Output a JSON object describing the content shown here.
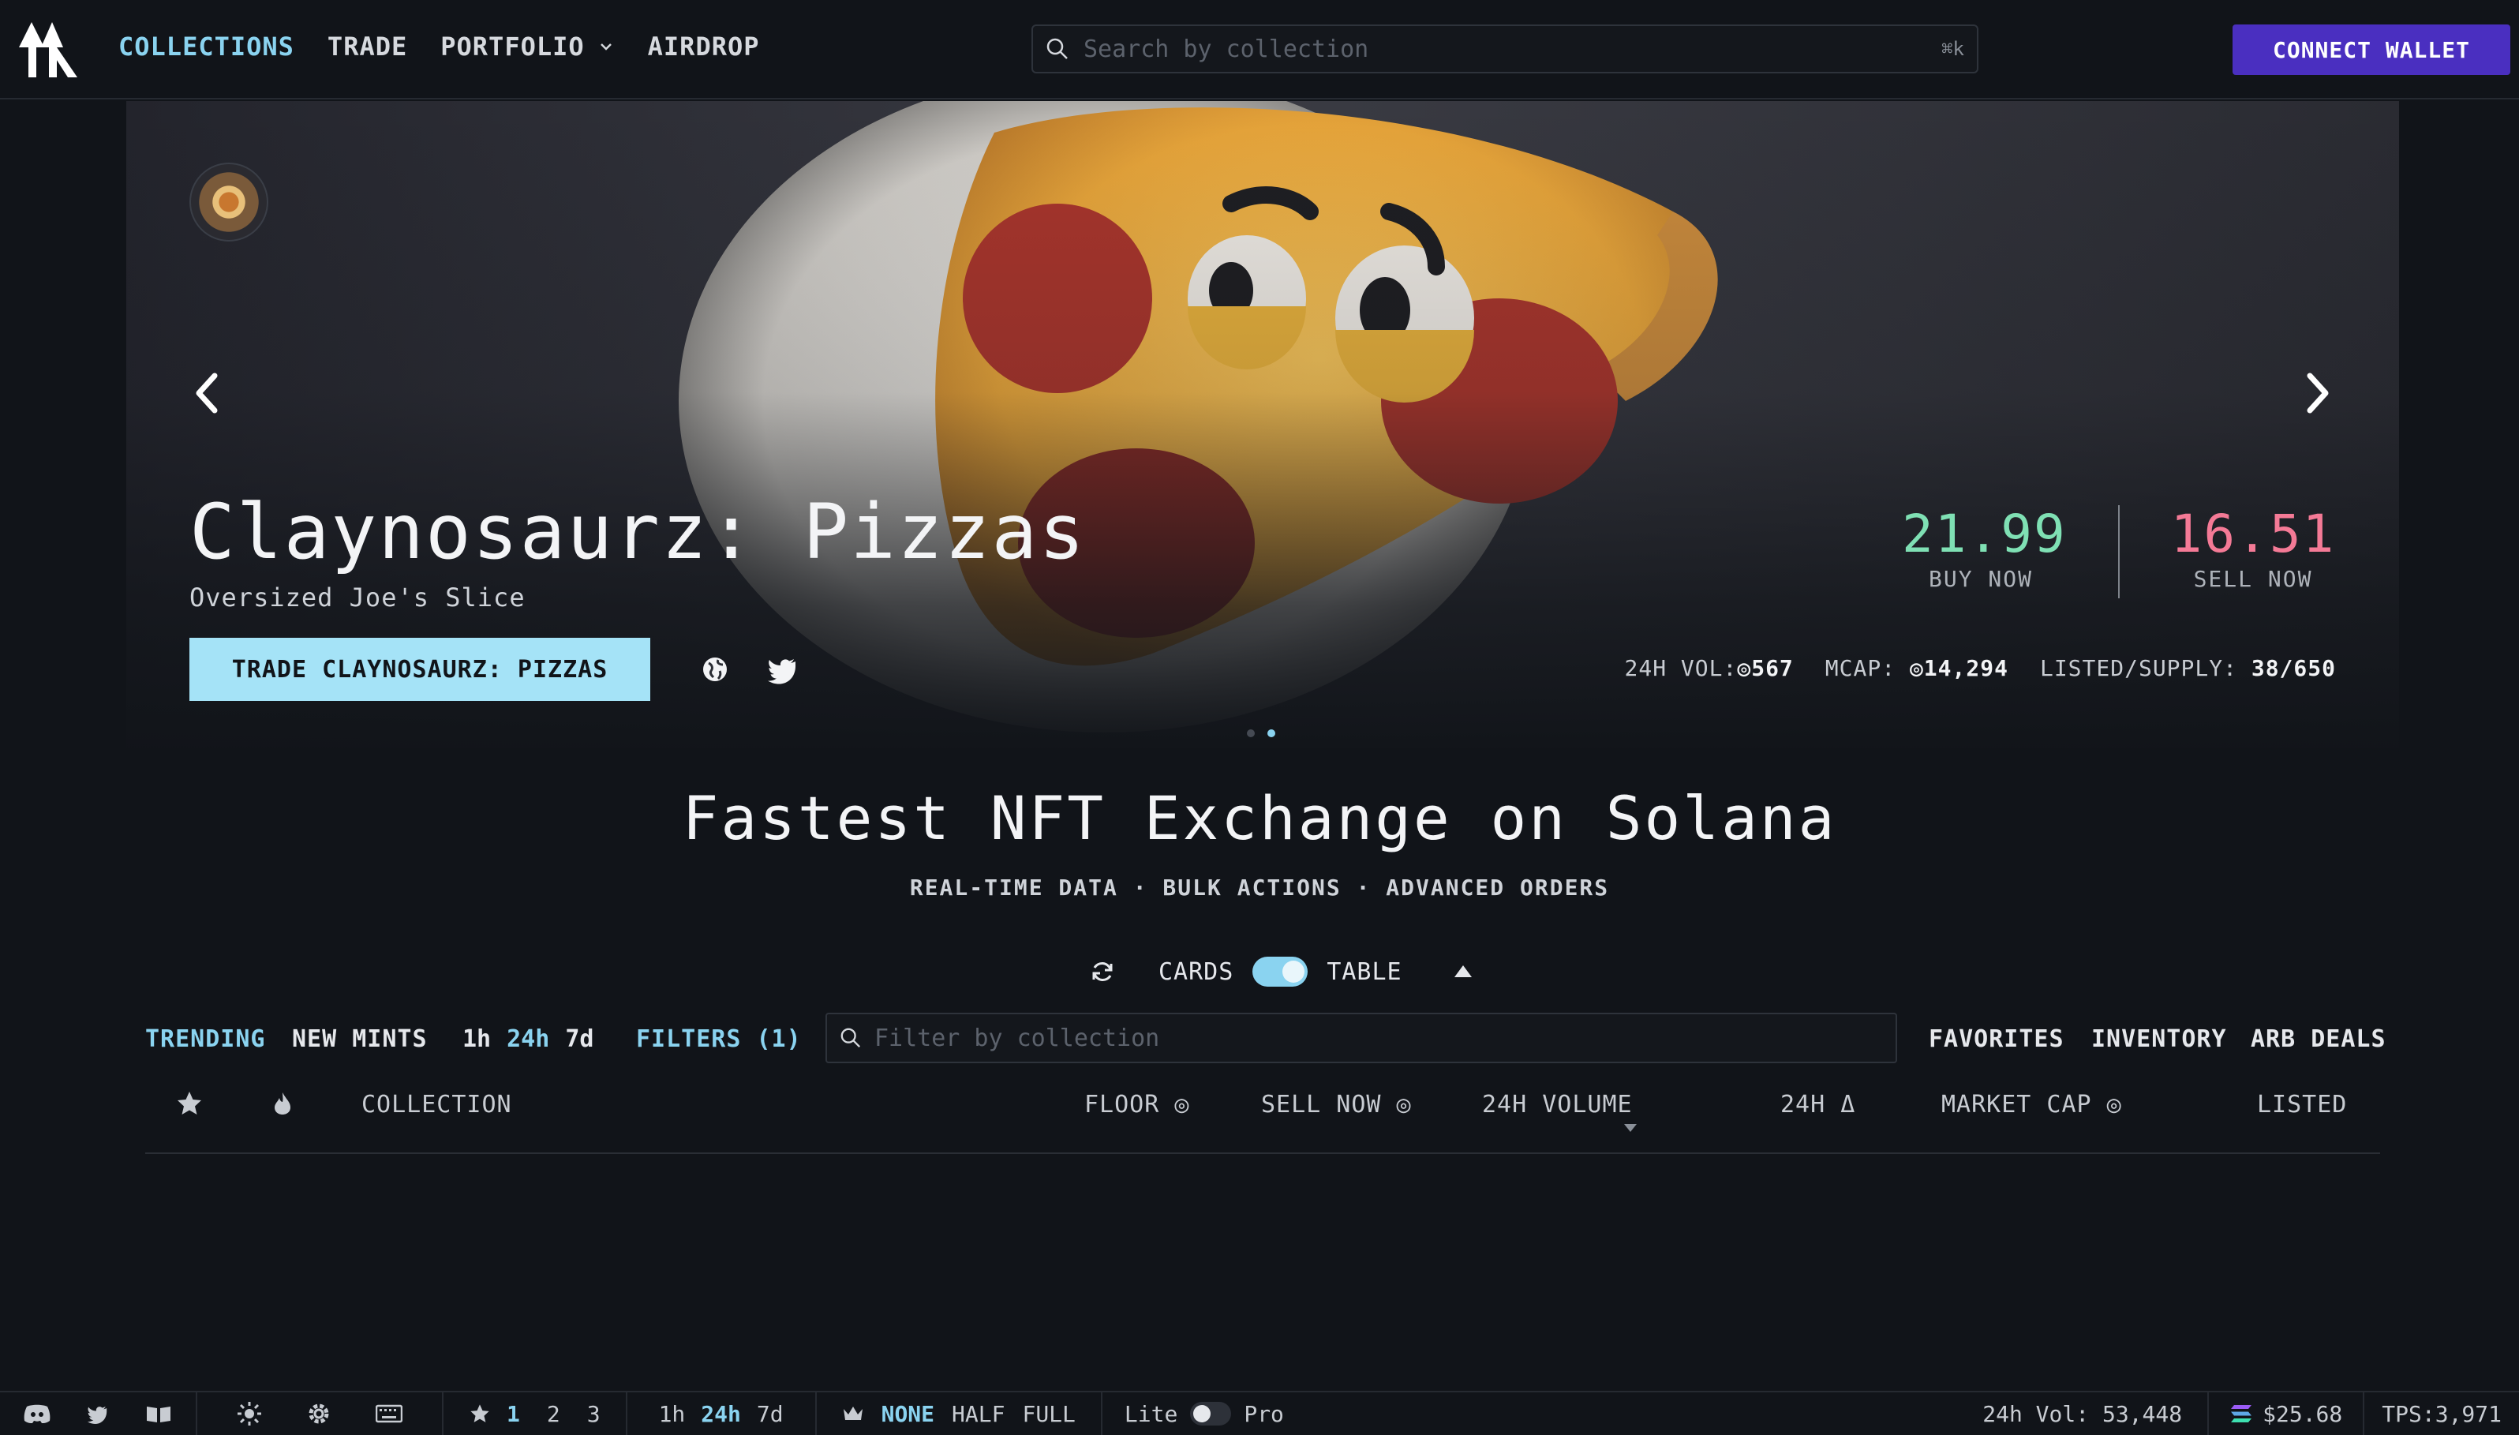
{
  "nav": {
    "links": [
      "COLLECTIONS",
      "TRADE",
      "PORTFOLIO",
      "AIRDROP"
    ],
    "search_placeholder": "Search by collection",
    "search_shortcut": "⌘k",
    "connect_label": "CONNECT WALLET"
  },
  "hero": {
    "title": "Claynosaurz: Pizzas",
    "subtitle": "Oversized Joe's Slice",
    "trade_label": "TRADE CLAYNOSAURZ: PIZZAS",
    "buy_price": "21.99",
    "buy_label": "BUY NOW",
    "sell_price": "16.51",
    "sell_label": "SELL NOW",
    "stats": {
      "vol_label": "24H VOL:",
      "vol_value": "◎567",
      "mcap_label": "MCAP:",
      "mcap_value": "◎14,294",
      "listed_label": "LISTED/SUPPLY:",
      "listed_value": "38/650"
    },
    "slides_active": 2,
    "slides_total": 2
  },
  "tagline": "Fastest NFT Exchange on Solana",
  "subtagline": "REAL-TIME DATA · BULK ACTIONS · ADVANCED ORDERS",
  "view": {
    "cards_label": "CARDS",
    "table_label": "TABLE"
  },
  "filters": {
    "trending": "TRENDING",
    "new_mints": "NEW MINTS",
    "timeframes": [
      "1h",
      "24h",
      "7d"
    ],
    "active_timeframe": "24h",
    "filters_label": "FILTERS (1)",
    "collection_placeholder": "Filter by collection",
    "favorites": "FAVORITES",
    "inventory": "INVENTORY",
    "arb_deals": "ARB DEALS"
  },
  "table": {
    "columns": {
      "collection": "COLLECTION",
      "floor": "FLOOR ◎",
      "sell_now": "SELL NOW ◎",
      "volume_24h": "24H VOLUME",
      "change_24h": "24H Δ",
      "market_cap": "MARKET CAP ◎",
      "listed": "LISTED"
    }
  },
  "bottom": {
    "favorite_sets": [
      "1",
      "2",
      "3"
    ],
    "timeframes": [
      "1h",
      "24h",
      "7d"
    ],
    "royalty": [
      "NONE",
      "HALF",
      "FULL"
    ],
    "mode_lite": "Lite",
    "mode_pro": "Pro",
    "vol_text": "24h Vol: 53,448",
    "sol_price": "$25.68",
    "tps": "TPS:3,971"
  },
  "colors": {
    "accent": "#8ad3f0",
    "connect": "#4a2fc0",
    "buy": "#7fe0b4",
    "sell": "#f47a96"
  }
}
